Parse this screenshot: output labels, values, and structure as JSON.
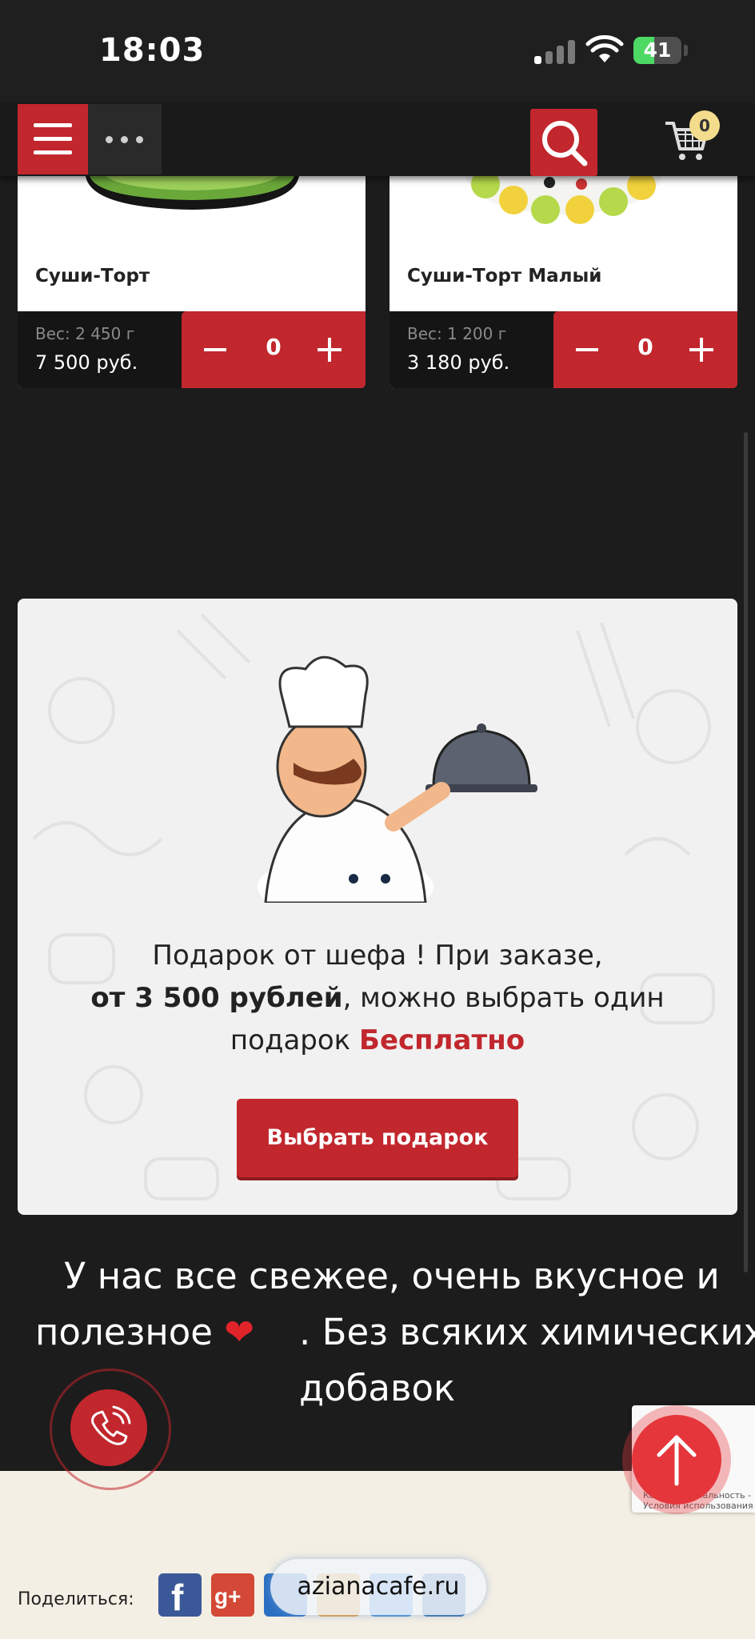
{
  "status_bar": {
    "time": "18:03",
    "battery": "41"
  },
  "header": {
    "cart_count": "0"
  },
  "products": [
    {
      "name": "Суши-Торт",
      "weight": "Вес: 2 450 г",
      "price": "7 500 руб.",
      "qty": "0"
    },
    {
      "name": "Суши-Торт Малый",
      "weight": "Вес: 1 200 г",
      "price": "3 180 руб.",
      "qty": "0"
    }
  ],
  "gift": {
    "line1": "Подарок от шефа ! При заказе,",
    "line2_bold": "от 3 500 рублей",
    "line2_rest": ", можно выбрать один",
    "line3_start": "подарок ",
    "line3_free": "Бесплатно",
    "button": "Выбрать подарок"
  },
  "fresh": {
    "line1": "У нас все свежее, очень вкусное и",
    "line2_a": "полезное",
    "line2_b": ". Без всяких химических",
    "line3": "добавок"
  },
  "recaptcha": {
    "line1": "Конфиденциальность -",
    "line2": "Условия использования"
  },
  "footer": {
    "share_label": "Поделиться:",
    "url": "azianacafe.ru"
  },
  "colors": {
    "accent": "#c1272d",
    "background": "#1c1c1c",
    "panel": "#f1f1f1"
  }
}
